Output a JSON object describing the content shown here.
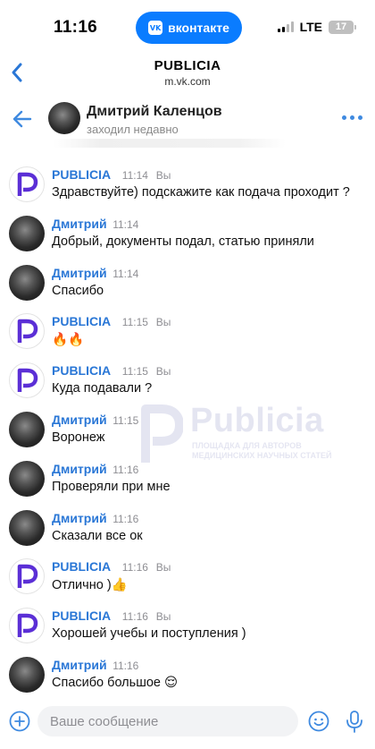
{
  "status_bar": {
    "time": "11:16",
    "vk_label": "вконтакте",
    "network": "LTE",
    "battery": "17"
  },
  "browser": {
    "title": "PUBLICIA",
    "url": "m.vk.com"
  },
  "chat": {
    "name": "Дмитрий Каленцов",
    "status": "заходил недавно"
  },
  "self_label": "Вы",
  "messages": [
    {
      "sender": "PUBLICIA",
      "time": "11:14",
      "self": true,
      "text": "Здравствуйте) подскажите как подача проходит ?"
    },
    {
      "sender": "Дмитрий",
      "time": "11:14",
      "self": false,
      "text": "Добрый, документы подал, статью приняли"
    },
    {
      "sender": "Дмитрий",
      "time": "11:14",
      "self": false,
      "text": "Спасибо"
    },
    {
      "sender": "PUBLICIA",
      "time": "11:15",
      "self": true,
      "text": "🔥🔥"
    },
    {
      "sender": "PUBLICIA",
      "time": "11:15",
      "self": true,
      "text": "Куда подавали ?"
    },
    {
      "sender": "Дмитрий",
      "time": "11:15",
      "self": false,
      "text": "Воронеж"
    },
    {
      "sender": "Дмитрий",
      "time": "11:16",
      "self": false,
      "text": "Проверяли при мне"
    },
    {
      "sender": "Дмитрий",
      "time": "11:16",
      "self": false,
      "text": "Сказали все ок"
    },
    {
      "sender": "PUBLICIA",
      "time": "11:16",
      "self": true,
      "text": "Отлично )👍"
    },
    {
      "sender": "PUBLICIA",
      "time": "11:16",
      "self": true,
      "text": "Хорошей учебы и поступления )"
    },
    {
      "sender": "Дмитрий",
      "time": "11:16",
      "self": false,
      "text": "Спасибо большое 😌"
    }
  ],
  "watermark": {
    "brand": "Publicia",
    "line1": "ПЛОЩАДКА ДЛЯ АВТОРОВ",
    "line2": "МЕДИЦИНСКИХ НАУЧНЫХ СТАТЕЙ"
  },
  "input": {
    "placeholder": "Ваше сообщение",
    "value": ""
  },
  "colors": {
    "accent": "#2a77d6",
    "vk_blue": "#0a7cff",
    "brand_purple": "#5b2fd6"
  },
  "icons": {
    "back": "chevron-left-icon",
    "nav_back": "arrow-left-icon",
    "more": "more-dots-icon",
    "attach": "plus-circle-icon",
    "emoji": "emoji-icon",
    "mic": "microphone-icon"
  }
}
